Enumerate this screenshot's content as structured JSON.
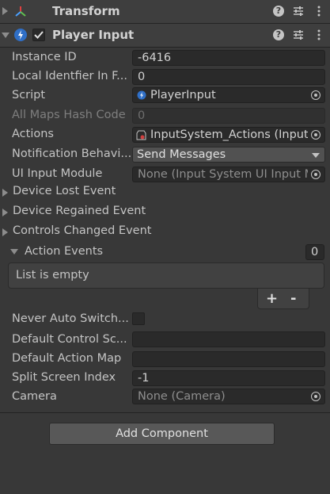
{
  "transform": {
    "title": "Transform"
  },
  "player_input": {
    "title": "Player Input",
    "enabled": true
  },
  "fields": {
    "instance_id": {
      "label": "Instance ID",
      "value": "-6416"
    },
    "local_identifier": {
      "label": "Local Identfier In F...",
      "value": "0"
    },
    "script": {
      "label": "Script",
      "value": "PlayerInput"
    },
    "all_maps_hash": {
      "label": "All Maps Hash Code",
      "value": "0"
    },
    "actions": {
      "label": "Actions",
      "value": "InputSystem_Actions (Input A"
    },
    "notification_behavior": {
      "label": "Notification Behavi...",
      "value": "Send Messages"
    },
    "ui_input_module": {
      "label": "UI Input Module",
      "value": "None (Input System UI Input M"
    }
  },
  "events": {
    "device_lost": "Device Lost Event",
    "device_regained": "Device Regained Event",
    "controls_changed": "Controls Changed Event"
  },
  "action_events": {
    "label": "Action Events",
    "count": "0",
    "empty_text": "List is empty",
    "add": "+",
    "remove": "-"
  },
  "fields2": {
    "never_auto_switch": {
      "label": "Never Auto Switch...",
      "checked": false
    },
    "default_control_scheme": {
      "label": "Default Control Sc...",
      "value": ""
    },
    "default_action_map": {
      "label": "Default Action Map",
      "value": ""
    },
    "split_screen_index": {
      "label": "Split Screen Index",
      "value": "-1"
    },
    "camera": {
      "label": "Camera",
      "value": "None (Camera)"
    }
  },
  "add_component": "Add Component",
  "colors": {
    "background": "#383838",
    "field": "#2a2a2a",
    "text": "#c4c4c4"
  }
}
